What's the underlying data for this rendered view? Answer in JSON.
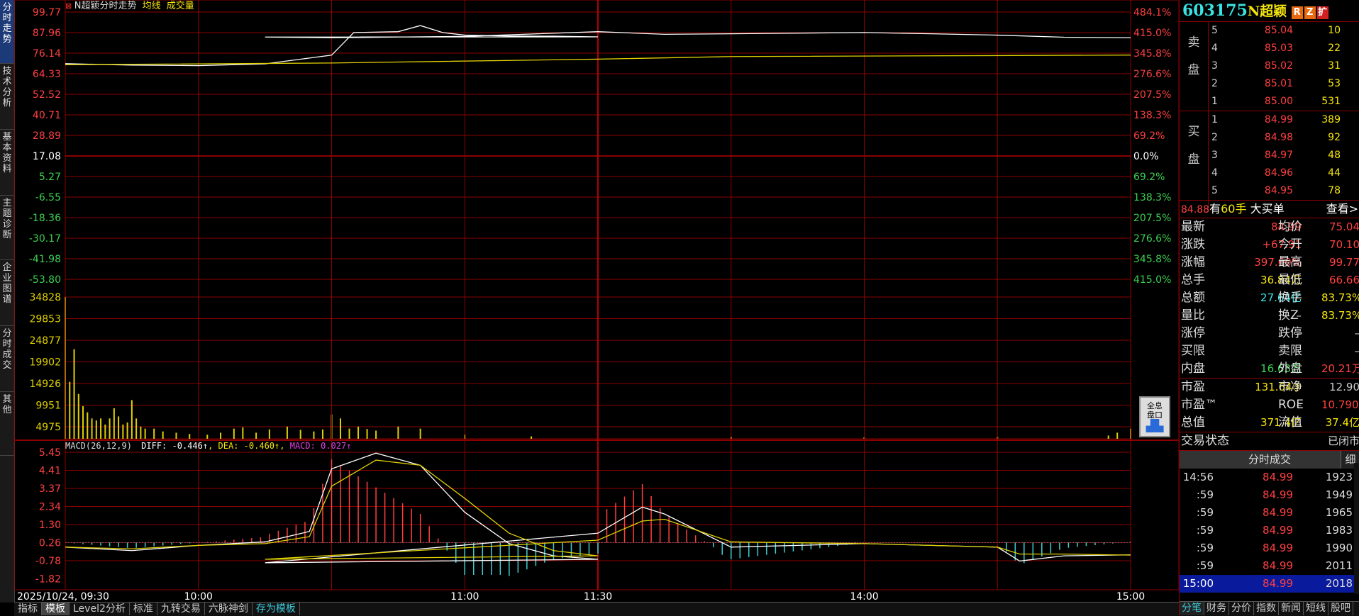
{
  "left_tabs": [
    {
      "label": "分时走势",
      "active": true
    },
    {
      "label": "技术分析",
      "active": false
    },
    {
      "label": "基本资料",
      "active": false
    },
    {
      "label": "主题诊断",
      "active": false
    },
    {
      "label": "企业图谱",
      "active": false
    },
    {
      "label": "分时成交",
      "active": false
    },
    {
      "label": "其他",
      "active": false
    }
  ],
  "chart_header": {
    "stock_label": "N超颖分时走势",
    "avg_label": "均线",
    "vol_label": "成交量"
  },
  "macd_header": {
    "params": "MACD(26,12,9)",
    "diff": "DIFF: -0.446↑",
    "dea": "DEA: -0.460↑",
    "macd": "MACD: 0.027↑"
  },
  "colors": {
    "up": "#ff4040",
    "down": "#3cd0d0",
    "price_line": "#ffffff",
    "avg_line": "#e0d000",
    "grid": "#8b0000",
    "volume": "#e0d000",
    "cyan_text": "#39e4e4",
    "yellow_text": "#f5e50d"
  },
  "chart_data": [
    {
      "type": "line",
      "panel": "price",
      "series": [
        {
          "name": "",
          "x": [
            "09:30",
            "09:45",
            "10:00",
            "10:15",
            "10:30",
            "10:35",
            "10:45",
            "10:50",
            "10:55",
            "11:00",
            "11:10",
            "11:20",
            "11:30",
            "11:45",
            "12:00",
            "12:30",
            "13:00",
            "13:15",
            "13:30",
            "14:00",
            "14:15",
            "14:30",
            "14:45",
            "15:00"
          ],
          "values": [
            70.1,
            69.3,
            69.0,
            70.0,
            75.0,
            88.0,
            88.5,
            92.0,
            88.0,
            86.5,
            86.0,
            85.9,
            85.5,
            85.4,
            85.0,
            85.8,
            88.5,
            87.0,
            87.3,
            88.0,
            87.3,
            86.5,
            85.3,
            84.99
          ]
        },
        {
          "name": "均线",
          "x": [
            "09:30",
            "10:30",
            "11:30",
            "13:30",
            "15:00"
          ],
          "values": [
            69.5,
            70.5,
            72.7,
            74.2,
            75.04
          ]
        }
      ],
      "y_ticks_left": [
        "99.77",
        "87.96",
        "76.14",
        "64.33",
        "52.52",
        "40.71",
        "28.89",
        "17.08",
        "5.27",
        "-6.55",
        "-18.36",
        "-30.17",
        "-41.98",
        "-53.80"
      ],
      "y_ticks_right": [
        "484.1%",
        "415.0%",
        "345.8%",
        "276.6%",
        "207.5%",
        "138.3%",
        "69.2%",
        "0.0%",
        "69.2%",
        "138.3%",
        "207.5%",
        "276.6%",
        "345.8%",
        "415.0%"
      ],
      "ylim": [
        -53.8,
        99.77
      ]
    },
    {
      "type": "bar",
      "panel": "volume",
      "y_ticks": [
        "34828",
        "29853",
        "24877",
        "19902",
        "14926",
        "9951",
        "4975"
      ],
      "ylim": [
        0,
        34828
      ],
      "x": [
        "09:30",
        "09:31",
        "09:32",
        "09:33",
        "09:34",
        "09:35",
        "09:36",
        "09:37",
        "09:38",
        "09:39",
        "09:40",
        "09:41",
        "09:42",
        "09:43",
        "09:44",
        "09:45",
        "09:46",
        "09:47",
        "09:48",
        "09:50",
        "09:52",
        "09:55",
        "09:58",
        "10:02",
        "10:05",
        "10:08",
        "10:10",
        "10:13",
        "10:16",
        "10:20",
        "10:23",
        "10:26",
        "10:28",
        "10:30",
        "10:32",
        "10:34",
        "10:36",
        "10:38",
        "10:40",
        "10:45",
        "10:50",
        "11:00",
        "11:15",
        "11:30",
        "13:30",
        "14:00",
        "14:30",
        "14:55",
        "14:57",
        "15:00"
      ],
      "values": [
        34828,
        14000,
        22000,
        11000,
        8000,
        6500,
        5000,
        4500,
        5000,
        3500,
        5000,
        7500,
        5500,
        3500,
        4000,
        9500,
        5000,
        3000,
        2500,
        2500,
        1800,
        1500,
        1200,
        1000,
        1500,
        2500,
        2800,
        1500,
        2300,
        3000,
        2200,
        1800,
        2300,
        6000,
        5000,
        2500,
        3000,
        2400,
        2000,
        3000,
        2500,
        1000,
        600,
        500,
        500,
        400,
        500,
        800,
        1500,
        2500
      ]
    },
    {
      "type": "line",
      "panel": "macd",
      "y_ticks": [
        "5.45",
        "4.41",
        "3.37",
        "2.34",
        "1.30",
        "0.26",
        "-0.78",
        "-1.82"
      ],
      "ylim": [
        -1.82,
        5.45
      ],
      "series": [
        {
          "name": "DIFF",
          "x": [
            "09:30",
            "09:45",
            "10:00",
            "10:15",
            "10:25",
            "10:30",
            "10:40",
            "10:50",
            "11:00",
            "11:10",
            "11:20",
            "11:30",
            "11:45",
            "13:00",
            "13:10",
            "13:15",
            "13:30",
            "14:00",
            "14:30",
            "14:35",
            "14:45",
            "15:00"
          ],
          "values": [
            0.0,
            -0.2,
            0.1,
            0.3,
            0.9,
            4.5,
            5.4,
            4.7,
            2.0,
            0.2,
            -0.5,
            -0.7,
            -0.9,
            0.8,
            2.3,
            1.9,
            0.0,
            0.2,
            0.0,
            -0.8,
            -0.5,
            -0.446
          ]
        },
        {
          "name": "DEA",
          "x": [
            "09:30",
            "09:45",
            "10:00",
            "10:15",
            "10:25",
            "10:30",
            "10:40",
            "10:50",
            "11:00",
            "11:10",
            "11:20",
            "11:30",
            "11:45",
            "13:00",
            "13:10",
            "13:15",
            "13:30",
            "14:00",
            "14:30",
            "14:35",
            "14:45",
            "15:00"
          ],
          "values": [
            0.0,
            -0.1,
            0.1,
            0.2,
            0.6,
            3.5,
            5.0,
            4.7,
            2.8,
            0.8,
            -0.2,
            -0.5,
            -0.7,
            0.4,
            1.5,
            1.6,
            0.3,
            0.2,
            0.0,
            -0.4,
            -0.4,
            -0.46
          ]
        }
      ]
    }
  ],
  "time_axis": {
    "labels": [
      "2025/10/24, 09:30",
      "10:00",
      "11:00",
      "11:30",
      "14:00",
      "15:00"
    ]
  },
  "bottom_tabs": [
    {
      "label": "指标",
      "active": false,
      "cyan": false
    },
    {
      "label": "模板",
      "active": true,
      "cyan": false
    },
    {
      "label": "Level2分析",
      "active": false,
      "cyan": false
    },
    {
      "label": "标准",
      "active": false,
      "cyan": false
    },
    {
      "label": "九转交易",
      "active": false,
      "cyan": false
    },
    {
      "label": "六脉神剑",
      "active": false,
      "cyan": false
    },
    {
      "label": "存为模板",
      "active": false,
      "cyan": true
    }
  ],
  "full_disk_button": {
    "line1": "全息",
    "line2": "盘口"
  },
  "right_panel": {
    "code": "603175",
    "name": "N超颖",
    "badges": [
      {
        "t": "R",
        "c": "#e86a10"
      },
      {
        "t": "Z",
        "c": "#e86a10"
      },
      {
        "t": "扩",
        "c": "#d02020"
      }
    ],
    "sell_label": [
      "卖",
      "盘"
    ],
    "buy_label": [
      "买",
      "盘"
    ],
    "sell": [
      {
        "lv": "5",
        "price": "85.04",
        "vol": "10"
      },
      {
        "lv": "4",
        "price": "85.03",
        "vol": "22"
      },
      {
        "lv": "3",
        "price": "85.02",
        "vol": "31"
      },
      {
        "lv": "2",
        "price": "85.01",
        "vol": "53"
      },
      {
        "lv": "1",
        "price": "85.00",
        "vol": "531"
      }
    ],
    "buy": [
      {
        "lv": "1",
        "price": "84.99",
        "vol": "389"
      },
      {
        "lv": "2",
        "price": "84.98",
        "vol": "92"
      },
      {
        "lv": "3",
        "price": "84.97",
        "vol": "48"
      },
      {
        "lv": "4",
        "price": "84.96",
        "vol": "44"
      },
      {
        "lv": "5",
        "price": "84.95",
        "vol": "78"
      }
    ],
    "big_order": {
      "price": "84.88",
      "pre": "有",
      "count": "60手",
      "post": " 大买单",
      "more": "查看>"
    },
    "quotes": [
      {
        "l1": "最新",
        "v1": "84.99",
        "c1": "#ff4040",
        "l2": "均价",
        "v2": "75.04",
        "c2": "#ff4040"
      },
      {
        "l1": "涨跌",
        "v1": "+67.91",
        "c1": "#ff4040",
        "l2": "今开",
        "v2": "70.10",
        "c2": "#ff4040"
      },
      {
        "l1": "涨幅",
        "v1": "397.60%",
        "c1": "#ff4040",
        "l2": "最高",
        "v2": "99.77",
        "c2": "#ff4040"
      },
      {
        "l1": "总手",
        "v1": "36.84万",
        "c1": "#f5e50d",
        "l2": "最低",
        "v2": "66.66",
        "c2": "#ff4040"
      },
      {
        "l1": "总额",
        "v1": "27.64亿",
        "c1": "#39e4e4",
        "l2": "换手",
        "v2": "83.73%",
        "c2": "#f5e50d"
      },
      {
        "l1": "量比",
        "v1": "–",
        "c1": "#ccc",
        "l2": "换Z",
        "v2": "83.73%",
        "c2": "#f5e50d"
      },
      {
        "l1": "涨停",
        "v1": "–",
        "c1": "#ccc",
        "l2": "跌停",
        "v2": "–",
        "c2": "#ccc"
      },
      {
        "l1": "买限",
        "v1": "–",
        "c1": "#ccc",
        "l2": "卖限",
        "v2": "–",
        "c2": "#ccc"
      },
      {
        "l1": "内盘",
        "v1": "16.63万",
        "c1": "#3cd050",
        "l2": "外盘",
        "v2": "20.21万",
        "c2": "#ff4040"
      },
      {
        "l1": "市盈",
        "v1": "131.64③",
        "c1": "#f5e50d",
        "l2": "市净",
        "v2": "12.90",
        "c2": "#ccc"
      },
      {
        "l1": "市盈™",
        "v1": "–",
        "c1": "#ccc",
        "l2": "ROE",
        "v2": "10.790%",
        "c2": "#ff4040"
      },
      {
        "l1": "总值",
        "v1": "371.4亿",
        "c1": "#f5e50d",
        "l2": "流值",
        "v2": "37.4亿",
        "c2": "#f5e50d"
      },
      {
        "l1": "交易状态",
        "v1": "",
        "c1": "#ccc",
        "l2": "",
        "v2": "已闭市",
        "c2": "#ddd"
      }
    ],
    "trade_header": "分时成交",
    "trade_detail_btn": "细",
    "trades": [
      {
        "t": "14:56",
        "p": "84.99",
        "v": "1923"
      },
      {
        "t": ":59",
        "p": "84.99",
        "v": "1949"
      },
      {
        "t": ":59",
        "p": "84.99",
        "v": "1965"
      },
      {
        "t": ":59",
        "p": "84.99",
        "v": "1983"
      },
      {
        "t": ":59",
        "p": "84.99",
        "v": "1990"
      },
      {
        "t": ":59",
        "p": "84.99",
        "v": "2011"
      },
      {
        "t": "15:00",
        "p": "84.99",
        "v": "2018",
        "sel": true
      }
    ],
    "tabs": [
      "分笔",
      "财务",
      "分价",
      "指数",
      "新闻",
      "短线",
      "股吧"
    ]
  }
}
